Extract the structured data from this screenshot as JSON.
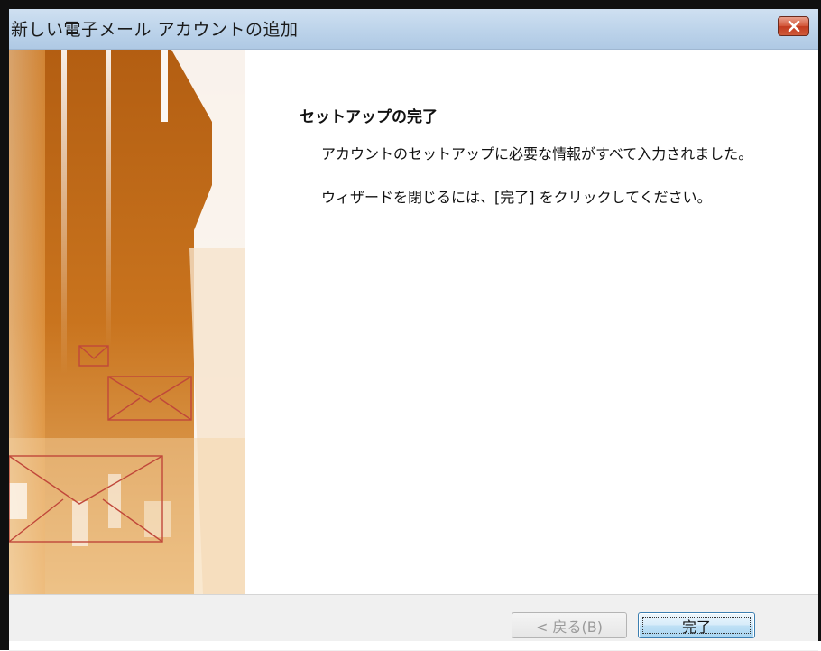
{
  "window": {
    "title": "新しい電子メール アカウントの追加",
    "close_icon": "close-icon"
  },
  "main": {
    "heading": "セットアップの完了",
    "message_1": "アカウントのセットアップに必要な情報がすべて入力されました。",
    "message_2": "ウィザードを閉じるには、[完了] をクリックしてください。"
  },
  "footer": {
    "back_label": "< 戻る(B)",
    "finish_label": "完了"
  },
  "colors": {
    "banner_orange": "#d58b2f",
    "titlebar_blue": "#bcd3ea",
    "close_red": "#c23b1f"
  }
}
